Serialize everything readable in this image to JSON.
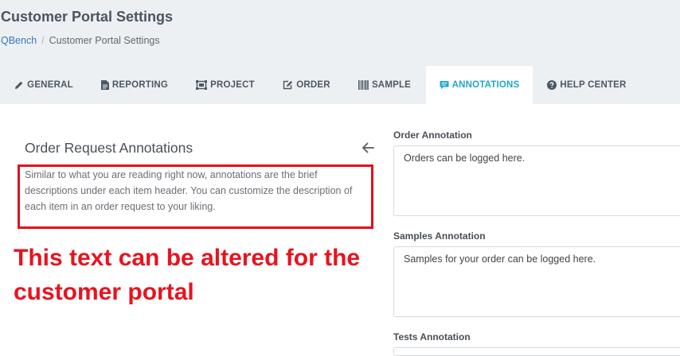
{
  "header": {
    "title": "Customer Portal Settings",
    "breadcrumb": {
      "root": "QBench",
      "separator": "/",
      "current": "Customer Portal Settings"
    }
  },
  "tabs": [
    {
      "label": "GENERAL",
      "icon": "pencil-icon"
    },
    {
      "label": "REPORTING",
      "icon": "file-icon"
    },
    {
      "label": "PROJECT",
      "icon": "project-icon"
    },
    {
      "label": "ORDER",
      "icon": "edit-icon"
    },
    {
      "label": "SAMPLE",
      "icon": "barcode-icon"
    },
    {
      "label": "ANNOTATIONS",
      "icon": "comment-icon",
      "active": true
    },
    {
      "label": "HELP CENTER",
      "icon": "question-circle-icon"
    }
  ],
  "left_panel": {
    "title": "Order Request Annotations",
    "description": "Similar to what you are reading right now, annotations are the brief descriptions under each item header. You can customize the description of each item in an order request to your liking.",
    "callout": "This text can be altered for the customer portal"
  },
  "fields": [
    {
      "label": "Order Annotation",
      "value": "Orders can be logged here."
    },
    {
      "label": "Samples Annotation",
      "value": "Samples for your order can be logged here."
    },
    {
      "label": "Tests Annotation",
      "value": ""
    }
  ],
  "colors": {
    "header_bg": "#edf0f3",
    "active_tab": "#1fa7c9",
    "callout_red": "#e8131f",
    "link": "#337ab7"
  }
}
